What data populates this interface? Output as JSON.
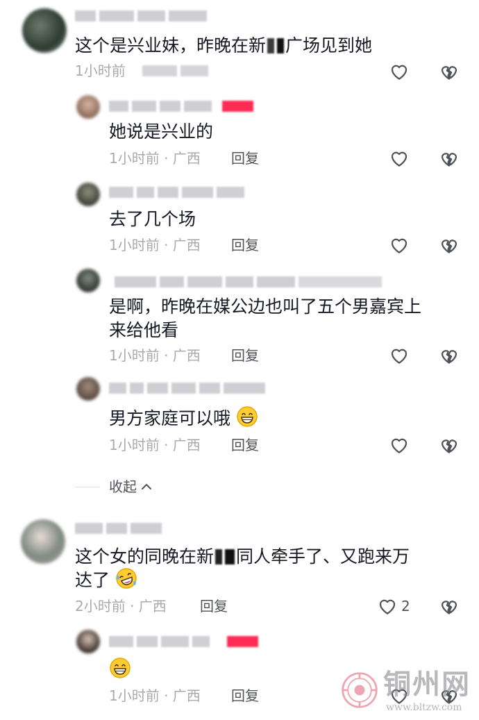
{
  "comments": [
    {
      "text_before": "这个是兴业妹，昨晚在新",
      "text_after": "广场见到她",
      "time": "1小时前",
      "replies": [
        {
          "text": "她说是兴业的",
          "time": "1小时前 · 广西",
          "reply_label": "回复"
        },
        {
          "text": "去了几个场",
          "time": "1小时前 · 广西",
          "reply_label": "回复"
        },
        {
          "text_line1": "是啊，昨晚在媒公边也叫了五个男嘉宾上",
          "text_line2": "来给他看",
          "time": "1小时前 · 广西",
          "reply_label": "回复"
        },
        {
          "text": "男方家庭可以哦",
          "emoji": "grin-emoji",
          "time": "1小时前 · 广西",
          "reply_label": "回复"
        }
      ]
    },
    {
      "text_before": "这个女的同晚在新",
      "text_after": "同人牵手了、又跑来万",
      "text_line2": "达了",
      "emoji": "laugh-cry-emoji",
      "time": "2小时前 · 广西",
      "reply_label": "回复",
      "like_count": "2",
      "replies": [
        {
          "emoji": "grin-emoji",
          "time": "1小时前 · 广西",
          "reply_label": "回复"
        }
      ]
    }
  ],
  "collapse_label": "收起",
  "watermark": {
    "brand": "铜州网",
    "url": "www.bltzw.com"
  },
  "colors": {
    "muted": "#a9a9ae",
    "text": "#161823",
    "badge": "#fe2c55"
  },
  "icons": {
    "like": "heart-outline-icon",
    "dislike": "broken-heart-icon",
    "collapse": "chevron-up-icon"
  }
}
